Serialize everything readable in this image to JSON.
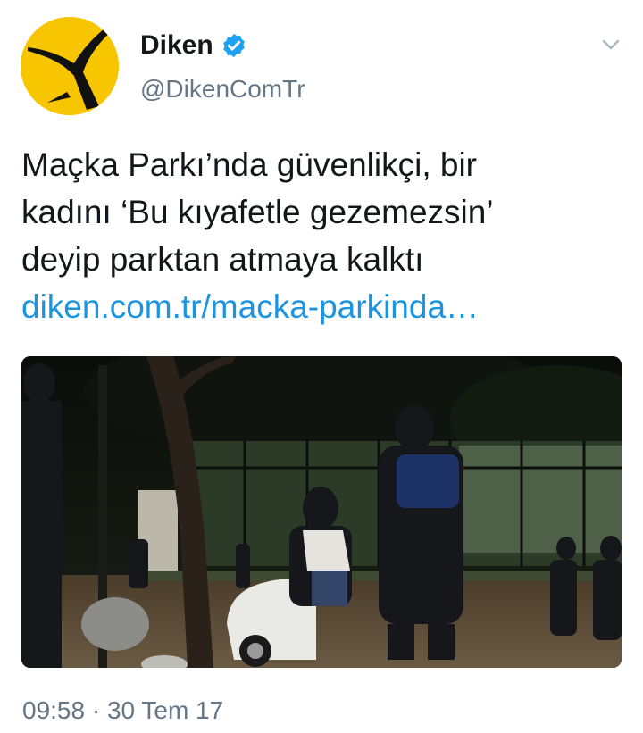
{
  "account": {
    "display_name": "Diken",
    "handle": "@DikenComTr",
    "verified": true,
    "avatar_icon": "diken-logo-icon",
    "avatar_color": "#f7c600"
  },
  "tweet": {
    "lines": [
      "Maçka Parkı’nda güvenlikçi, bir",
      "kadını ‘Bu kıyafetle gezemezsin’",
      "deyip parktan atmaya kalktı"
    ],
    "link_text": "diken.com.tr/macka-parkinda…",
    "timestamp": "09:58 · 30 Tem 17"
  },
  "colors": {
    "link": "#1b95e0",
    "secondary_text": "#657786",
    "verified_badge": "#1da1f2"
  },
  "icons": {
    "menu": "chevron-down-icon",
    "verified": "verified-badge-icon"
  }
}
